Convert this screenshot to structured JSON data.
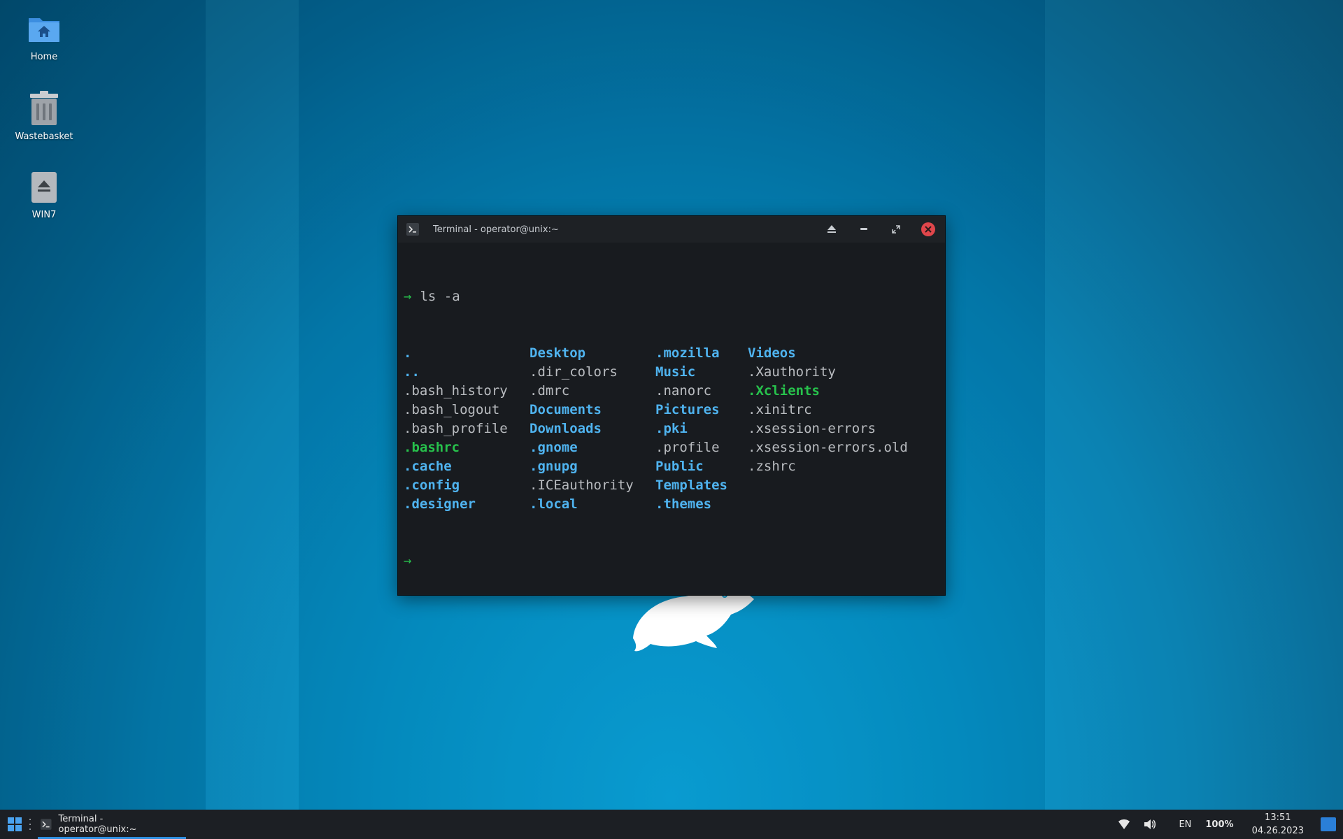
{
  "desktop": {
    "icons": [
      {
        "label": "Home"
      },
      {
        "label": "Wastebasket"
      },
      {
        "label": "WIN7"
      }
    ]
  },
  "window": {
    "title": "Terminal - operator@unix:~"
  },
  "terminal": {
    "prompt_symbol": "→",
    "command": "ls -a",
    "columns": [
      [
        {
          "name": ".",
          "type": "dir"
        },
        {
          "name": "..",
          "type": "dir"
        },
        {
          "name": ".bash_history",
          "type": "file"
        },
        {
          "name": ".bash_logout",
          "type": "file"
        },
        {
          "name": ".bash_profile",
          "type": "file"
        },
        {
          "name": ".bashrc",
          "type": "exec"
        },
        {
          "name": ".cache",
          "type": "dir"
        },
        {
          "name": ".config",
          "type": "dir"
        },
        {
          "name": ".designer",
          "type": "dir"
        }
      ],
      [
        {
          "name": "Desktop",
          "type": "dir"
        },
        {
          "name": ".dir_colors",
          "type": "file"
        },
        {
          "name": ".dmrc",
          "type": "file"
        },
        {
          "name": "Documents",
          "type": "dir"
        },
        {
          "name": "Downloads",
          "type": "dir"
        },
        {
          "name": ".gnome",
          "type": "dir"
        },
        {
          "name": ".gnupg",
          "type": "dir"
        },
        {
          "name": ".ICEauthority",
          "type": "file"
        },
        {
          "name": ".local",
          "type": "dir"
        }
      ],
      [
        {
          "name": ".mozilla",
          "type": "dir"
        },
        {
          "name": "Music",
          "type": "dir"
        },
        {
          "name": ".nanorc",
          "type": "file"
        },
        {
          "name": "Pictures",
          "type": "dir"
        },
        {
          "name": ".pki",
          "type": "dir"
        },
        {
          "name": ".profile",
          "type": "file"
        },
        {
          "name": "Public",
          "type": "dir"
        },
        {
          "name": "Templates",
          "type": "dir"
        },
        {
          "name": ".themes",
          "type": "dir"
        }
      ],
      [
        {
          "name": "Videos",
          "type": "dir"
        },
        {
          "name": ".Xauthority",
          "type": "file"
        },
        {
          "name": ".Xclients",
          "type": "exec"
        },
        {
          "name": ".xinitrc",
          "type": "file"
        },
        {
          "name": ".xsession-errors",
          "type": "file"
        },
        {
          "name": ".xsession-errors.old",
          "type": "file"
        },
        {
          "name": ".zshrc",
          "type": "file"
        }
      ]
    ]
  },
  "taskbar": {
    "task_label": "Terminal - operator@unix:~",
    "language": "EN",
    "battery": "100%",
    "time": "13:51",
    "date": "04.26.2023"
  },
  "colors": {
    "dir": "#4fb3ef",
    "exec": "#27c24c",
    "file": "#b9bcc0",
    "close": "#e0464b"
  }
}
